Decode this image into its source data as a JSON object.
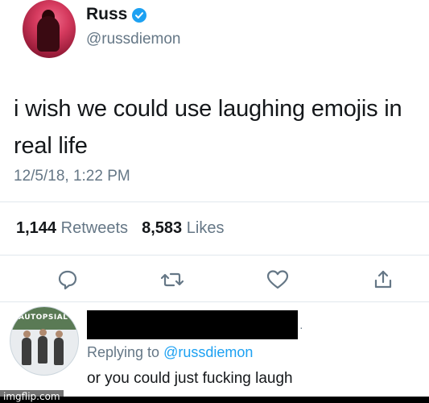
{
  "tweet": {
    "author_name": "Russ",
    "author_handle": "@russdiemon",
    "text": "i wish we could use laughing emojis in real life",
    "timestamp": "12/5/18, 1:22 PM",
    "retweets_count": "1,144",
    "retweets_label": "Retweets",
    "likes_count": "8,583",
    "likes_label": "Likes",
    "actions": [
      "reply-icon",
      "retweet-icon",
      "like-icon",
      "share-icon"
    ],
    "accent_color": "#1da1f2"
  },
  "reply": {
    "avatar_text": "AUTOPSIAL",
    "replying_prefix": "Replying to",
    "replying_handle": "@russdiemon",
    "text": "or you could just fucking laugh"
  },
  "watermark": "imgflip.com"
}
